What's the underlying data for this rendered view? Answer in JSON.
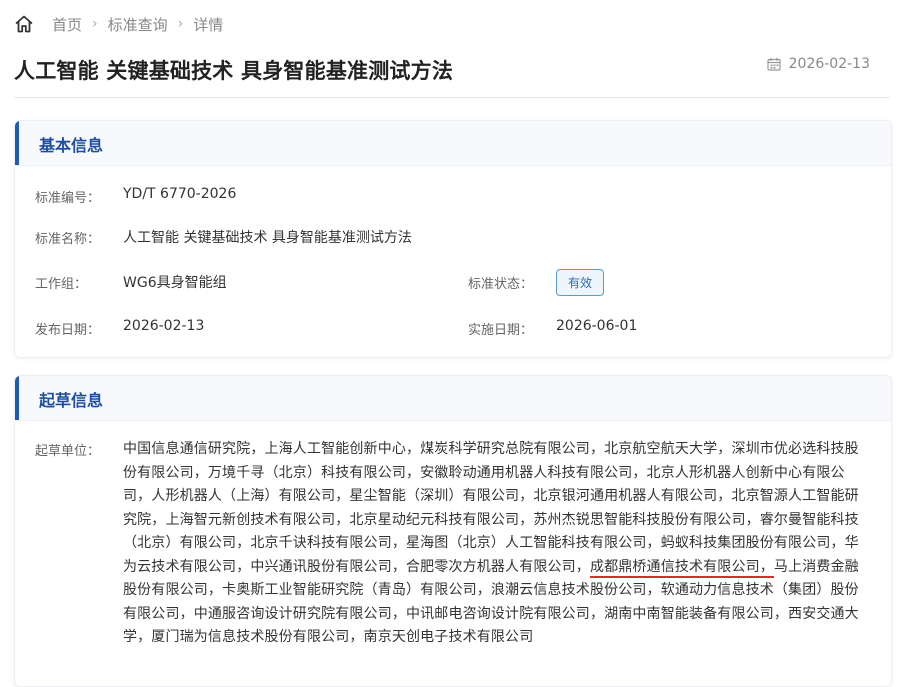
{
  "breadcrumb": {
    "home_icon": "home-icon",
    "items": [
      "首页",
      "标准查询",
      "详情"
    ]
  },
  "page": {
    "title": "人工智能 关键基础技术 具身智能基准测试方法",
    "date": "2026-02-13"
  },
  "basic": {
    "section_title": "基本信息",
    "fields": {
      "std_no_label": "标准编号：",
      "std_no": "YD/T 6770-2026",
      "std_name_label": "标准名称：",
      "std_name": "人工智能 关键基础技术 具身智能基准测试方法",
      "group_label": "工作组：",
      "group": "WG6具身智能组",
      "status_label": "标准状态：",
      "status": "有效",
      "publish_label": "发布日期：",
      "publish": "2026-02-13",
      "effective_label": "实施日期：",
      "effective": "2026-06-01"
    }
  },
  "draft": {
    "section_title": "起草信息",
    "org_label": "起草单位：",
    "orgs_before": "中国信息通信研究院，上海人工智能创新中心，煤炭科学研究总院有限公司，北京航空航天大学，深圳市优必选科技股份有限公司，万境千寻（北京）科技有限公司，安徽聆动通用机器人科技有限公司，北京人形机器人创新中心有限公司，人形机器人（上海）有限公司，星尘智能（深圳）有限公司，北京银河通用机器人有限公司，北京智源人工智能研究院，上海智元新创技术有限公司，北京星动纪元科技有限公司，苏州杰锐思智能科技股份有限公司，睿尔曼智能科技（北京）有限公司，北京千诀科技有限公司，星海图（北京）人工智能科技有限公司，蚂蚁科技集团股份有限公司，华为云技术有限公司，中兴通讯股份有限公司，合肥零次方机器人有限公司，",
    "orgs_highlight": "成都鼎桥通信技术有限公司，",
    "orgs_after": "马上消费金融股份有限公司，卡奥斯工业智能研究院（青岛）有限公司，浪潮云信息技术股份公司，软通动力信息技术（集团）股份有限公司，中通服咨询设计研究院有限公司，中讯邮电咨询设计院有限公司，湖南中南智能装备有限公司，西安交通大学，厦门瑞为信息技术股份有限公司，南京天创电子技术有限公司",
    "highlight_color": "#d92c2c"
  }
}
